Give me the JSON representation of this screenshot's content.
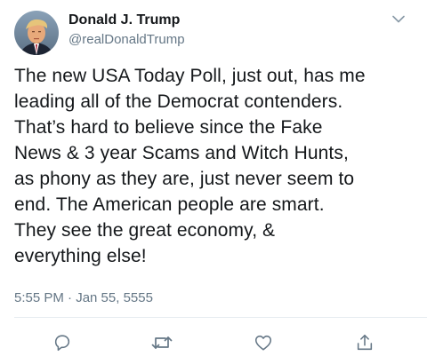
{
  "tweet": {
    "author_name": "Donald J. Trump",
    "author_handle": "@realDonaldTrump",
    "text_lines": [
      "The new USA Today Poll, just out, has me",
      "leading all of the Democrat contenders.",
      "That’s hard to believe since the Fake",
      "News & 3 year Scams and Witch Hunts,",
      "as phony as they are, just never seem to",
      "end. The American people are smart.",
      "They see the great economy, &",
      "everything else!"
    ],
    "timestamp": "5:55 PM · Jan 55, 5555"
  },
  "icons": {
    "caret": "chevron-down-icon",
    "reply": "reply-icon",
    "retweet": "retweet-icon",
    "like": "heart-icon",
    "share": "share-icon"
  },
  "colors": {
    "text": "#14171a",
    "secondary": "#657786",
    "icon": "#657786",
    "divider": "#e6ecf0"
  }
}
